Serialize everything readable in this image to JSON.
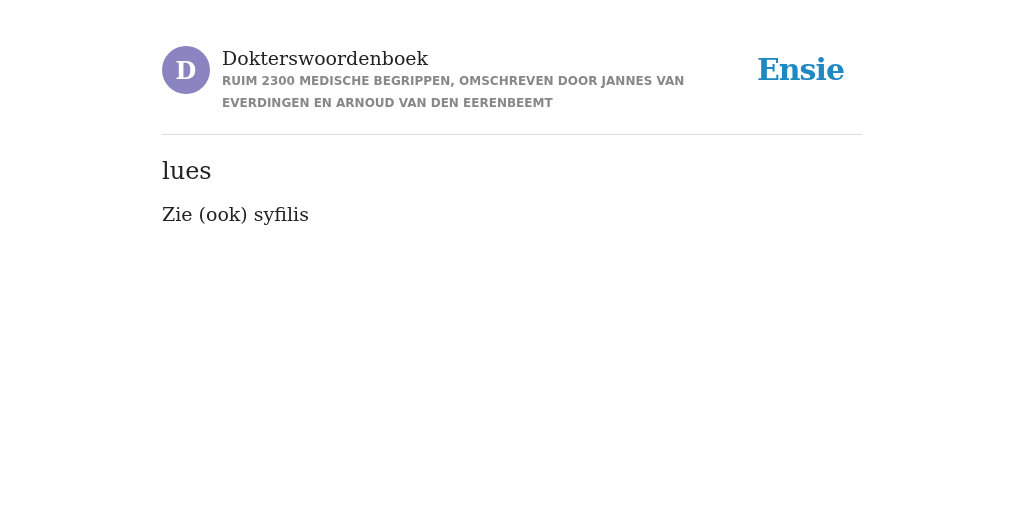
{
  "header": {
    "avatar_letter": "D",
    "title": "Dokterswoordenboek",
    "subtitle": "RUIM 2300 MEDISCHE BEGRIPPEN, OMSCHREVEN DOOR JANNES VAN EVERDINGEN EN ARNOUD VAN DEN EERENBEEMT",
    "logo": "Ensie"
  },
  "entry": {
    "term": "lues",
    "definition": "Zie (ook) syfilis"
  }
}
